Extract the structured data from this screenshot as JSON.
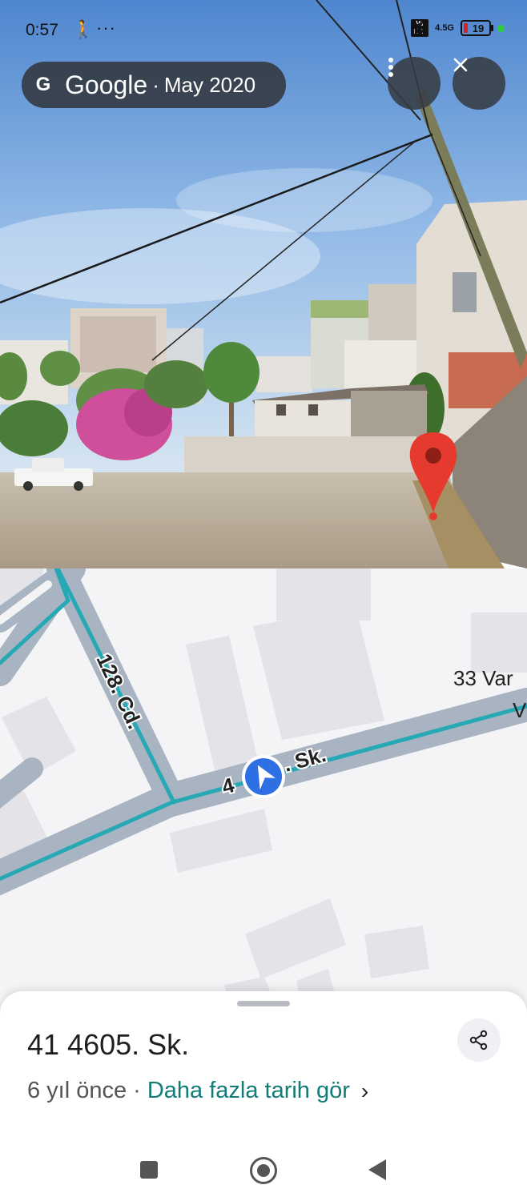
{
  "status_bar": {
    "time": "0:57",
    "network": "4.5G",
    "volte": "Vo LTE",
    "battery": "19",
    "icons": [
      "walk-icon",
      "more-dots-icon",
      "location-arrow-icon",
      "signal-icon",
      "battery-icon"
    ]
  },
  "street_view": {
    "brand": "Google",
    "separator": "·",
    "date": "May 2020",
    "menu_icon": "more-vert-icon",
    "close_icon": "close-icon",
    "pin_color": "#e63a2e"
  },
  "map": {
    "road_label_1": "128. Cd.",
    "road_label_2": "4",
    "road_label_3": ". Sk.",
    "label_right_1": "33 Var",
    "label_right_2": "V",
    "road_color": "#26a9b5"
  },
  "sheet": {
    "title": "41 4605. Sk.",
    "age": "6 yıl önce",
    "separator": "·",
    "more_dates_link": "Daha fazla tarih gör",
    "chevron": "›",
    "share_icon": "share-icon"
  },
  "nav_bar": {
    "icons": [
      "recent-apps-icon",
      "home-icon",
      "back-icon"
    ]
  }
}
